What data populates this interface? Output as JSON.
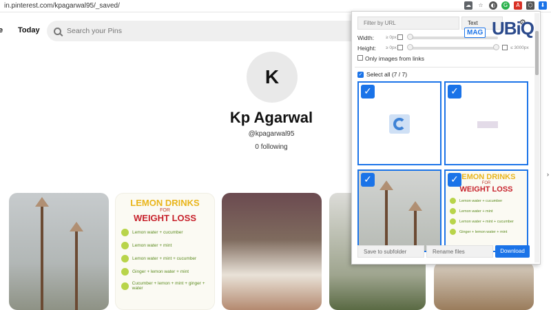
{
  "browser": {
    "url": "in.pinterest.com/kpagarwal95/_saved/"
  },
  "pinterest": {
    "home_label": "e",
    "today_label": "Today",
    "search_placeholder": "Search your Pins",
    "profile": {
      "initial": "K",
      "name": "Kp Agarwal",
      "username": "@kpagarwal95",
      "following": "0 following"
    },
    "pins": [
      {
        "title": "LEMON DRINKS",
        "for": "FOR",
        "subtitle": "WEIGHT LOSS",
        "items": [
          "Lemon water + cucumber",
          "Lemon water + mint",
          "Lemon water + mint + cucumber",
          "Ginger + lemon water + mint",
          "Cucumber + lemon + mint + ginger + water"
        ]
      }
    ]
  },
  "extension": {
    "filter_placeholder": "Filter by URL",
    "type_select": "Text",
    "width_label": "Width:",
    "height_label": "Height:",
    "min_label": "≥ 0px",
    "max_label": "≤ 3000px",
    "only_links_label": "Only images from links",
    "select_all_label": "Select all (7 / 7)",
    "save_subfolder_placeholder": "Save to subfolder",
    "rename_placeholder": "Rename files",
    "download_label": "Download",
    "tile_lemon_title": "LEMON DRINKS",
    "tile_lemon_for": "FOR",
    "tile_lemon_sub": "WEIGHT LOSS",
    "tile_lemon_items": [
      "Lemon water + cucumber",
      "Lemon water + mint",
      "Lemon water + mint + cucumber",
      "Ginger + lemon water + mint"
    ]
  },
  "watermark": {
    "mag": "MAG",
    "brand": "UBiQ"
  },
  "colors": {
    "accent": "#1a73e8",
    "brand_blue": "#2b4a8c",
    "brand_orange": "#f58a1f"
  }
}
